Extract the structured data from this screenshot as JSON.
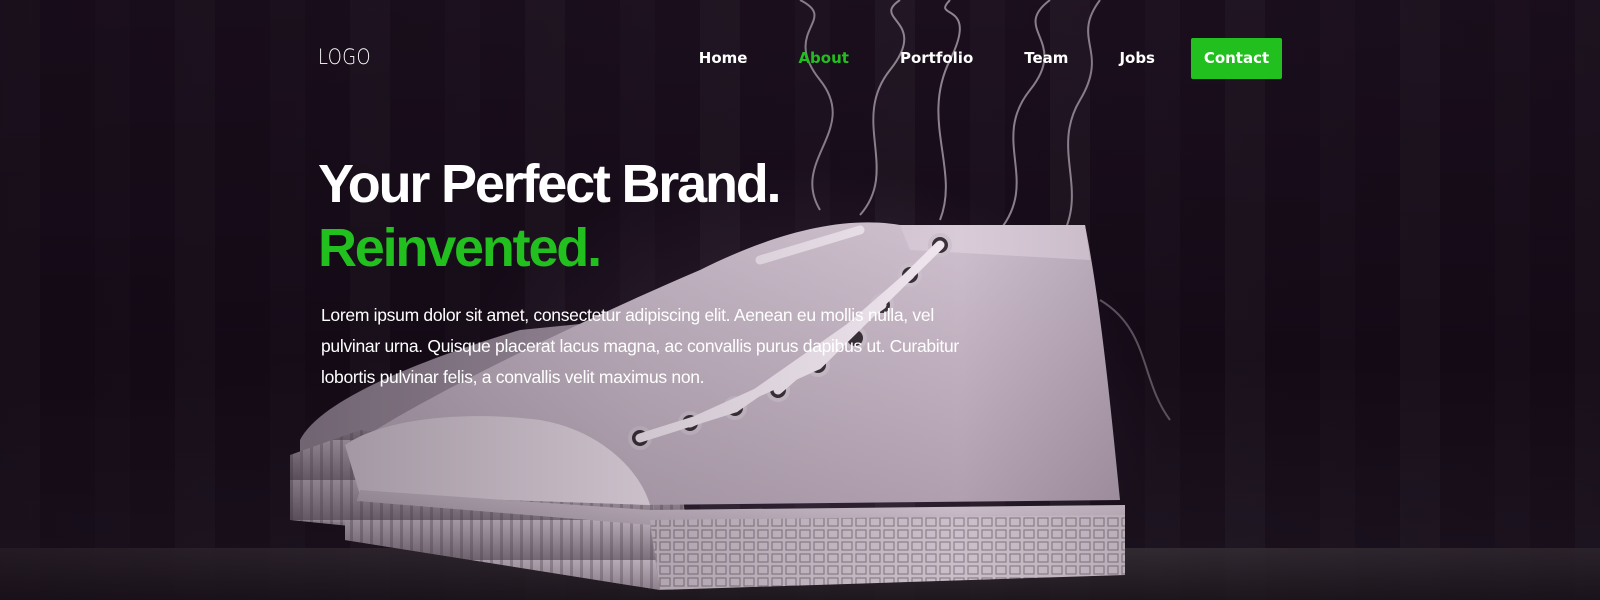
{
  "logo": "LOGO",
  "nav": {
    "items": [
      {
        "label": "Home",
        "active": false
      },
      {
        "label": "About",
        "active": true
      },
      {
        "label": "Portfolio",
        "active": false
      },
      {
        "label": "Team",
        "active": false
      },
      {
        "label": "Jobs",
        "active": false
      }
    ],
    "contact_label": "Contact"
  },
  "hero": {
    "title_line1": "Your Perfect Brand.",
    "title_line2": "Reinvented.",
    "body": "Lorem ipsum dolor sit amet, consectetur adipiscing elit. Aenean eu mollis nulla, vel pulvinar urna. Quisque placerat lacus magna, ac convallis purus dapibus ut. Curabitur lobortis pulvinar felis, a convallis velit maximus non."
  },
  "colors": {
    "accent": "#22c01e",
    "background": "#150a17",
    "text": "#ffffff"
  }
}
